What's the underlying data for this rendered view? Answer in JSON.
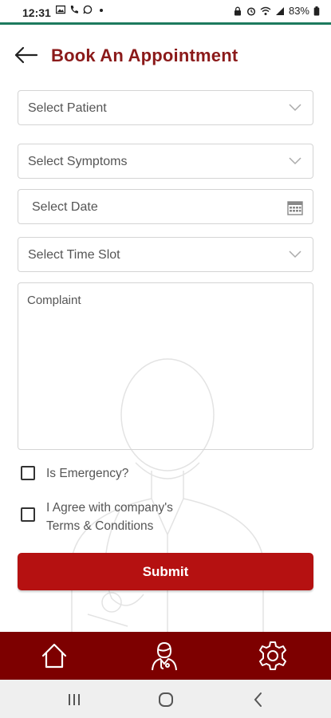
{
  "status_bar": {
    "time": "12:31",
    "battery": "83%",
    "icons_left": [
      "gallery-icon",
      "phone-icon",
      "whatsapp-icon",
      "dot-icon"
    ],
    "icons_right": [
      "lock-icon",
      "alarm-icon",
      "wifi-icon",
      "signal-icon",
      "battery-icon"
    ]
  },
  "header": {
    "title": "Book An Appointment"
  },
  "form": {
    "patient_placeholder": "Select Patient",
    "symptoms_placeholder": "Select Symptoms",
    "date_placeholder": "Select Date",
    "timeslot_placeholder": "Select Time Slot",
    "complaint_placeholder": "Complaint",
    "emergency_label": "Is Emergency?",
    "agree_label_line1": "I Agree with company's",
    "agree_label_line2": "Terms & Conditions",
    "submit_label": "Submit"
  },
  "bottom_nav": {
    "items": [
      "home-icon",
      "doctor-icon",
      "settings-icon"
    ]
  },
  "colors": {
    "title": "#8b1a1a",
    "submit": "#b51111",
    "bottom_nav": "#7d0000",
    "status_border": "#1d7a5e"
  }
}
